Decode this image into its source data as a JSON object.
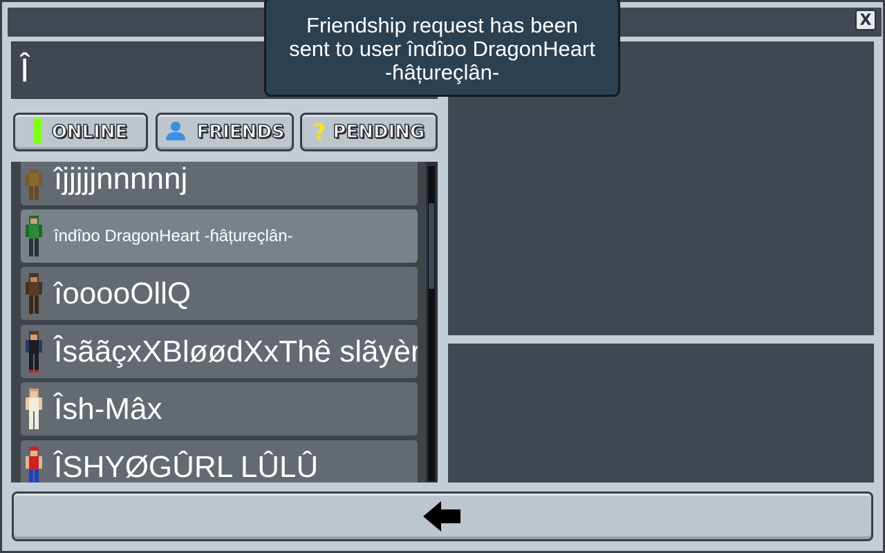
{
  "window": {
    "close_label": "X"
  },
  "search": {
    "value": "Î"
  },
  "tabs": [
    {
      "label": "ONLINE",
      "icon": "online-bar-icon",
      "icon_color": "#7cff1a"
    },
    {
      "label": "FRIENDS",
      "icon": "person-icon",
      "icon_color": "#3b8fe0"
    },
    {
      "label": "PENDING",
      "icon": "question-mark-icon",
      "icon_color": "#ffe21a"
    }
  ],
  "players": [
    {
      "name": "îjjjjjnnnnnj",
      "selected": false
    },
    {
      "name": "îndîɒo DragonHeart -ɦâțureçlân-",
      "selected": true
    },
    {
      "name": "îooooOllQ",
      "selected": false
    },
    {
      "name": "ÎsããçxXBløødXxThê slãyèr",
      "selected": false
    },
    {
      "name": "Îsh-Mâx",
      "selected": false
    },
    {
      "name": "ÎSHYØGÛRL LÛLÛ",
      "selected": false
    }
  ],
  "toast": {
    "lines": [
      "Friendship request has been",
      "sent to user îndîɒo DragonHeart",
      "-ɦâțureçlân-"
    ]
  },
  "footer": {
    "back_icon": "arrow-left-icon"
  },
  "colors": {
    "panel_dark": "#414750",
    "toast_bg": "#2b4050",
    "button_bg": "#bdc5cd"
  }
}
